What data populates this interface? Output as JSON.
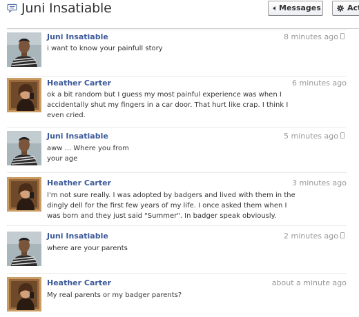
{
  "header": {
    "title": "Juni Insatiable",
    "messages_button": "Messages",
    "actions_button": "Actions"
  },
  "colors": {
    "author_link": "#3b5998",
    "timestamp": "#999999",
    "separator": "#e9e9e9"
  },
  "messages": [
    {
      "author": "Juni Insatiable",
      "time": "8 minutes ago",
      "sent_from_mobile": true,
      "lines": [
        "i want to know your painfull story"
      ]
    },
    {
      "author": "Heather Carter",
      "time": "6 minutes ago",
      "sent_from_mobile": false,
      "lines": [
        "ok a bit random but I guess my most painful experience was when I",
        "accidentally shut my fingers in a car door. That hurt like crap. I think I",
        "even cried."
      ]
    },
    {
      "author": "Juni Insatiable",
      "time": "5 minutes ago",
      "sent_from_mobile": true,
      "lines": [
        "aww ... Where you from",
        "your age"
      ]
    },
    {
      "author": "Heather Carter",
      "time": "3 minutes ago",
      "sent_from_mobile": false,
      "lines": [
        "I'm not sure really. I was adopted by badgers and lived with them in the",
        "dingly dell for the first few years of my life. I once asked them when I",
        "was born and they just said \"Summer\". In badger speak obviously."
      ]
    },
    {
      "author": "Juni Insatiable",
      "time": "2 minutes ago",
      "sent_from_mobile": true,
      "lines": [
        "where are your parents"
      ]
    },
    {
      "author": "Heather Carter",
      "time": "about a minute ago",
      "sent_from_mobile": false,
      "lines": [
        "My real parents or my badger parents?"
      ]
    }
  ]
}
